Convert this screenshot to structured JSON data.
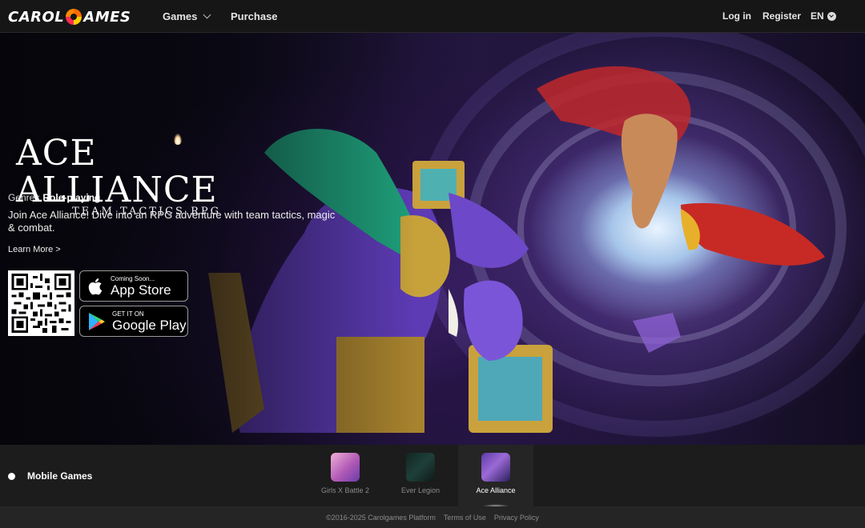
{
  "header": {
    "logo_left": "CAROL",
    "logo_right": "AMES",
    "nav": {
      "games": "Games",
      "purchase": "Purchase"
    },
    "login": "Log in",
    "register": "Register",
    "language": "EN"
  },
  "hero": {
    "title": "ACE ALLIANCE",
    "subtitle": "TEAM TACTICS RPG",
    "genre_label": "Genre :",
    "genre_value": "Role-playing",
    "description": "Join Ace Alliance! Dive into an RPG adventure with team tactics, magic & combat.",
    "learn_more": "Learn More >",
    "app_store": {
      "small": "Coming Soon...",
      "big": "App Store"
    },
    "google_play": {
      "small": "GET IT ON",
      "big": "Google Play"
    }
  },
  "strip": {
    "label": "Mobile Games",
    "games": [
      {
        "name": "Girls X Battle 2",
        "active": false
      },
      {
        "name": "Ever Legion",
        "active": false
      },
      {
        "name": "Ace Alliance",
        "active": true
      }
    ]
  },
  "footer": {
    "copyright": "©2016-2025 Carolgames Platform",
    "terms": "Terms of Use",
    "privacy": "Privacy Policy"
  },
  "colors": {
    "header_bg": "#161616",
    "strip_bg": "#1c1c1c",
    "footer_bg": "#252525"
  },
  "icons": {
    "apple": "apple-icon",
    "google_play": "google-play-icon",
    "language": "chevron-down-circle-icon"
  }
}
